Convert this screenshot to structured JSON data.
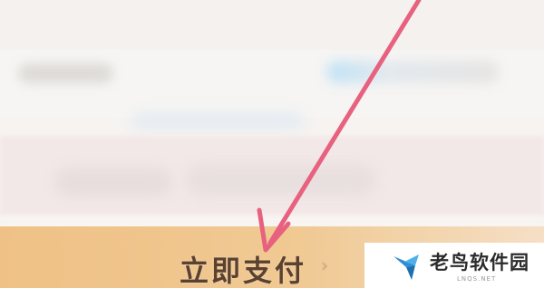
{
  "payment": {
    "button_label": "立即支付",
    "chevron": "›"
  },
  "watermark": {
    "brand_name": "老鸟软件园",
    "domain": "LNQS.NET",
    "logo_icon": "bird-logo-icon"
  },
  "annotation": {
    "arrow_color": "#e8617e",
    "icon": "pointer-arrow-icon"
  },
  "colors": {
    "pay_bar": "#efc186",
    "pay_text": "#5b4230",
    "logo_blue": "#2d8fd6"
  }
}
